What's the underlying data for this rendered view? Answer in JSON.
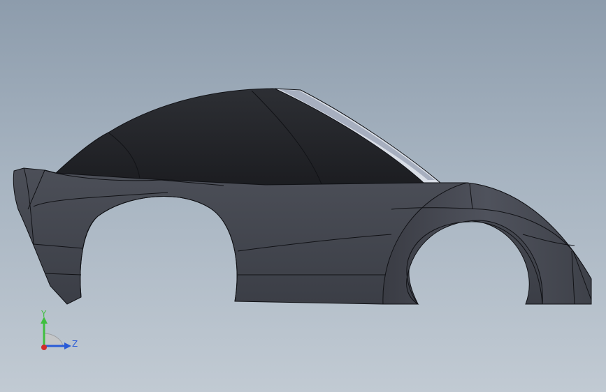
{
  "viewport": {
    "background_top": "#8d9cac",
    "background_bottom": "#c1cad3"
  },
  "model": {
    "body_color": "#43464f",
    "body_dark": "#2a2c31",
    "edge_color": "#111216",
    "glass_highlight": "#e6ebf2"
  },
  "triad": {
    "y_label": "Y",
    "z_label": "Z",
    "y_color": "#3fbf3f",
    "z_color": "#2a5bd7",
    "x_color": "#d12b2b"
  }
}
